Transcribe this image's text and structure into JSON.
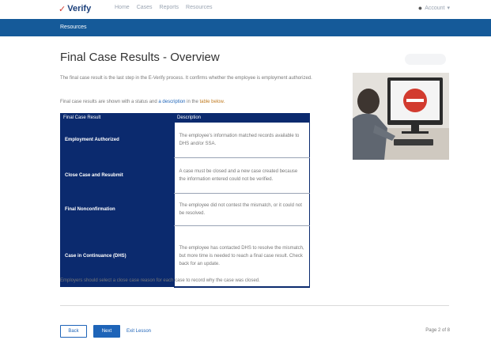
{
  "nav": {
    "logo_text": "Verify",
    "links": [
      "Home",
      "Cases",
      "Reports",
      "Resources"
    ],
    "user_label": "Account"
  },
  "breadcrumb": "Resources",
  "page": {
    "title": "Final Case Results - Overview",
    "intro": "The final case result is the last step in the E-Verify process. It confirms whether the employee is employment authorized.",
    "legend_prefix": "Final case results are shown with a status and",
    "legend_part1": "a description",
    "legend_mid": "in the",
    "legend_part2": "table below."
  },
  "table": {
    "headers": [
      "Final Case Result",
      "Description"
    ],
    "rows": [
      {
        "status": "Employment Authorized",
        "description": "The employee's information matched records available to DHS and/or SSA."
      },
      {
        "status": "Close Case and Resubmit",
        "description": "A case must be closed and a new case created because the information entered could not be verified."
      },
      {
        "status": "Final Nonconfirmation",
        "description": "The employee did not contest the mismatch, or it could not be resolved."
      },
      {
        "status": "Case in Continuance (DHS)",
        "description": "The employee has contacted DHS to resolve the mismatch, but more time is needed to reach a final case result. Check back for an update."
      }
    ]
  },
  "footnote": "Employers should select a close case reason for each case to record why the case was closed.",
  "buttons": {
    "back": "Back",
    "next": "Next",
    "exit": "Exit Lesson"
  },
  "pager": "Page 2 of 8",
  "colors": {
    "brand_blue": "#155a99",
    "table_navy": "#0b2a6e",
    "accent_red": "#d23b2f"
  },
  "icons": {
    "logo": "verify-logo-icon",
    "user": "user-icon",
    "chevron": "chevron-down-icon"
  }
}
